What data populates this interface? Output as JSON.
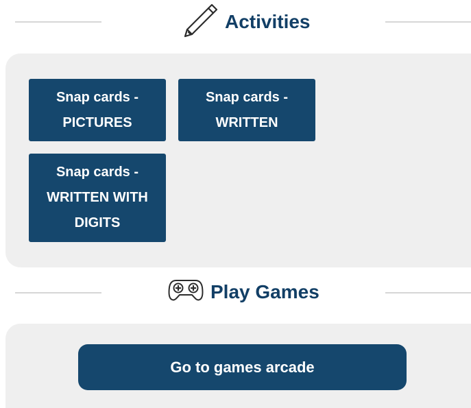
{
  "activities": {
    "title": "Activities",
    "icon": "pencil-icon",
    "tiles": [
      {
        "line1": "Snap cards -",
        "line2": "PICTURES"
      },
      {
        "line1": "Snap cards -",
        "line2": "WRITTEN"
      },
      {
        "line1": "Snap cards -",
        "line2": "WRITTEN WITH",
        "line3": "DIGITS"
      }
    ]
  },
  "games": {
    "title": "Play Games",
    "icon": "gamepad-icon",
    "button_label": "Go to games arcade"
  },
  "colors": {
    "primary": "#15476d",
    "heading": "#123f66",
    "panel": "#efefef",
    "rule": "#d6d6d6"
  }
}
